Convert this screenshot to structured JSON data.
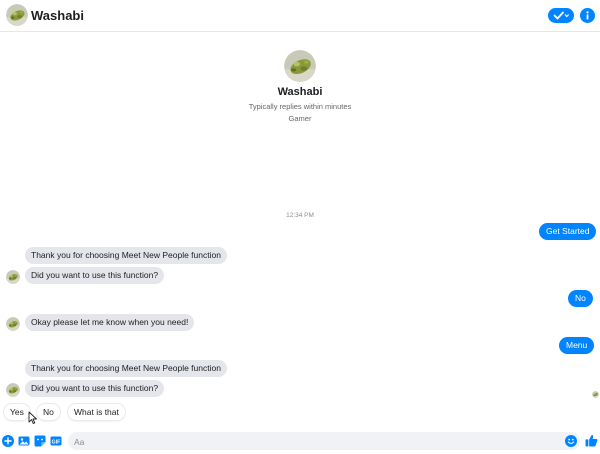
{
  "header": {
    "title": "Washabi",
    "icons": {
      "check": "check-dropdown-icon",
      "info": "info-icon"
    },
    "accent_color": "#0084ff"
  },
  "profile": {
    "name": "Washabi",
    "subtitle": "Typically replies within minutes",
    "category": "Gamer"
  },
  "conversation": {
    "timestamp": "12:34 PM",
    "outgoing": {
      "get_started": "Get Started",
      "no": "No",
      "menu": "Menu"
    },
    "incoming": {
      "thanks_1": "Thank you for choosing Meet New People function",
      "question_1": "Did you want to use this function?",
      "okay": "Okay please let me know when you need!",
      "thanks_2": "Thank you for choosing Meet New People function",
      "question_2": "Did you want to use this function?"
    }
  },
  "quick_replies": [
    "Yes",
    "No",
    "What is that"
  ],
  "composer": {
    "placeholder": "Aa",
    "icons": [
      "plus-icon",
      "image-icon",
      "sticker-icon",
      "gif-icon",
      "emoji-icon",
      "thumbs-up-icon"
    ]
  }
}
